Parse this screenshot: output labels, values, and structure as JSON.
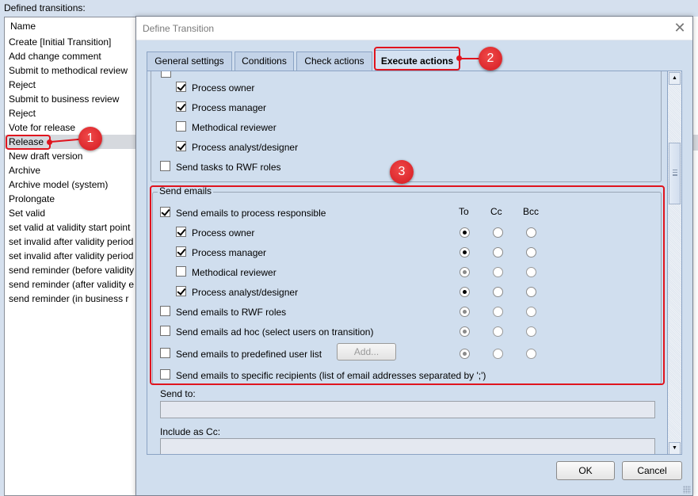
{
  "background": {
    "label": "Defined transitions:",
    "list_header": "Name",
    "items": [
      "Create [Initial Transition]",
      "Add change comment",
      "Submit to methodical review",
      "Reject",
      "Submit to business review",
      "Reject",
      "Vote for release",
      "Release",
      "New draft version",
      "Archive",
      "Archive model (system)",
      "Prolongate",
      "Set valid",
      "set valid at validity start point",
      "set invalid after validity period",
      "set invalid after validity period",
      "send reminder (before validity",
      "send reminder (after validity e",
      "send reminder (in business r"
    ],
    "selected_index": 7
  },
  "dialog": {
    "title": "Define Transition",
    "close_icon": "close-icon",
    "tabs": [
      {
        "label": "General settings",
        "active": false
      },
      {
        "label": "Conditions",
        "active": false
      },
      {
        "label": "Check actions",
        "active": false
      },
      {
        "label": "Execute actions",
        "active": true
      }
    ],
    "tasks_section": {
      "items": [
        {
          "label": "Process owner",
          "checked": true
        },
        {
          "label": "Process manager",
          "checked": true
        },
        {
          "label": "Methodical reviewer",
          "checked": false
        },
        {
          "label": "Process analyst/designer",
          "checked": true
        },
        {
          "label": "Send tasks to RWF roles",
          "checked": false
        }
      ]
    },
    "email_section": {
      "legend": "Send emails",
      "columns": [
        "To",
        "Cc",
        "Bcc"
      ],
      "rows": [
        {
          "label": "Send emails to process responsible",
          "checked": true,
          "radio": null
        },
        {
          "label": "Process owner",
          "checked": true,
          "radio": "To",
          "enabled": true
        },
        {
          "label": "Process manager",
          "checked": true,
          "radio": "To",
          "enabled": true
        },
        {
          "label": "Methodical reviewer",
          "checked": false,
          "radio": "To",
          "enabled": false
        },
        {
          "label": "Process analyst/designer",
          "checked": true,
          "radio": "To",
          "enabled": true
        },
        {
          "label": "Send emails to RWF roles",
          "checked": false,
          "radio": "To",
          "enabled": false
        },
        {
          "label": "Send emails ad hoc (select users on transition)",
          "checked": false,
          "radio": "To",
          "enabled": false
        },
        {
          "label": "Send emails to predefined user list",
          "checked": false,
          "radio": "To",
          "enabled": false
        },
        {
          "label": "Send emails to specific recipients (list of email addresses separated by ';')",
          "checked": false,
          "radio": null
        }
      ],
      "add_button": "Add..."
    },
    "send_to_label": "Send to:",
    "send_to_value": "",
    "include_cc_label": "Include as Cc:",
    "include_cc_value": "",
    "ok_label": "OK",
    "cancel_label": "Cancel"
  },
  "callouts": [
    "1",
    "2",
    "3"
  ],
  "colors": {
    "callout": "#e0141e",
    "dialog_bg": "#d0deee",
    "tab_border": "#8ba3c4"
  }
}
